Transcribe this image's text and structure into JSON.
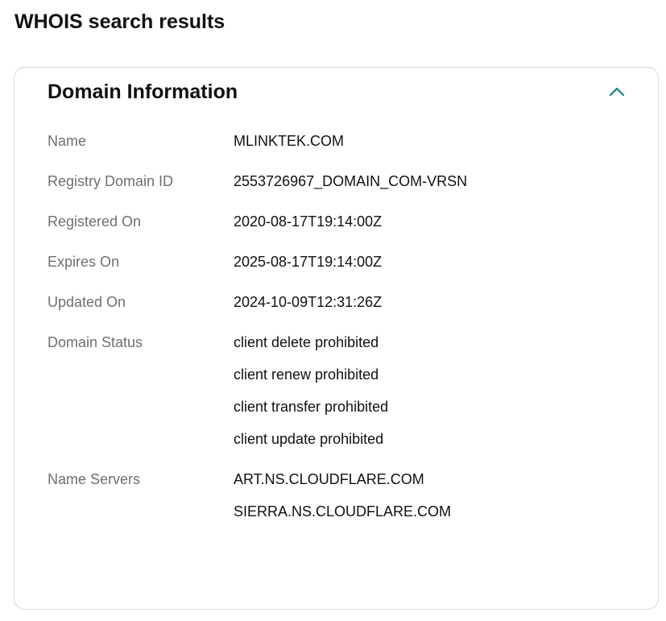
{
  "page": {
    "title": "WHOIS search results"
  },
  "card": {
    "title": "Domain Information",
    "collapse_icon": "chevron-up-icon",
    "accent_color": "#1b7f86"
  },
  "fields": [
    {
      "label": "Name",
      "values": [
        "MLINKTEK.COM"
      ]
    },
    {
      "label": "Registry Domain ID",
      "values": [
        "2553726967_DOMAIN_COM-VRSN"
      ]
    },
    {
      "label": "Registered On",
      "values": [
        "2020-08-17T19:14:00Z"
      ]
    },
    {
      "label": "Expires On",
      "values": [
        "2025-08-17T19:14:00Z"
      ]
    },
    {
      "label": "Updated On",
      "values": [
        "2024-10-09T12:31:26Z"
      ]
    },
    {
      "label": "Domain Status",
      "values": [
        "client delete prohibited",
        "client renew prohibited",
        "client transfer prohibited",
        "client update prohibited"
      ]
    },
    {
      "label": "Name Servers",
      "values": [
        "ART.NS.CLOUDFLARE.COM",
        "SIERRA.NS.CLOUDFLARE.COM"
      ]
    }
  ]
}
